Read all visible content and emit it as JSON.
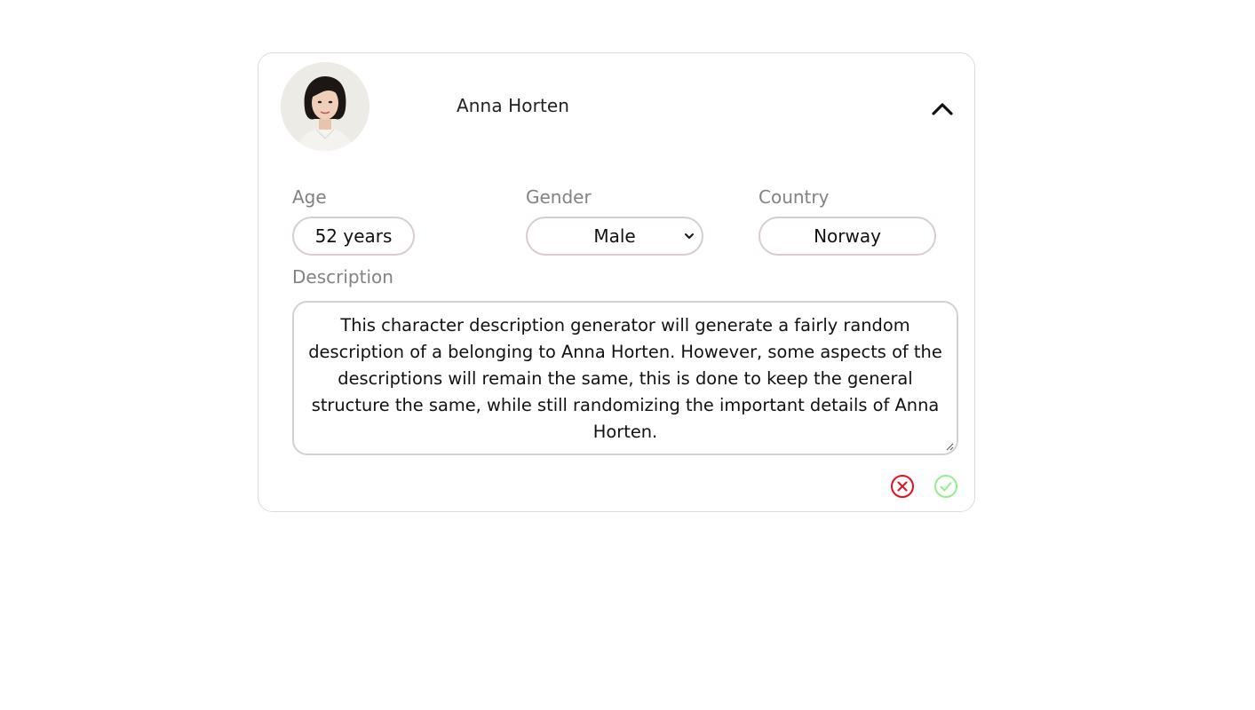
{
  "profile": {
    "name": "Anna Horten",
    "age_label": "Age",
    "age_value": "52 years",
    "gender_label": "Gender",
    "gender_value": "Male",
    "country_label": "Country",
    "country_value": "Norway",
    "description_label": "Description",
    "description_text": "This character description generator will generate a fairly random description of a belonging to Anna Horten. However, some aspects of the descriptions will remain the same, this is done to keep the general structure the same, while still randomizing the important details of Anna Horten."
  },
  "icons": {
    "collapse": "chevron-up-icon",
    "cancel": "cancel-circle-icon",
    "confirm": "check-circle-icon"
  },
  "colors": {
    "cancel": "#e3101b",
    "confirm": "#8ff08a",
    "pill_border": "#d8ccd3",
    "label": "#828282"
  }
}
